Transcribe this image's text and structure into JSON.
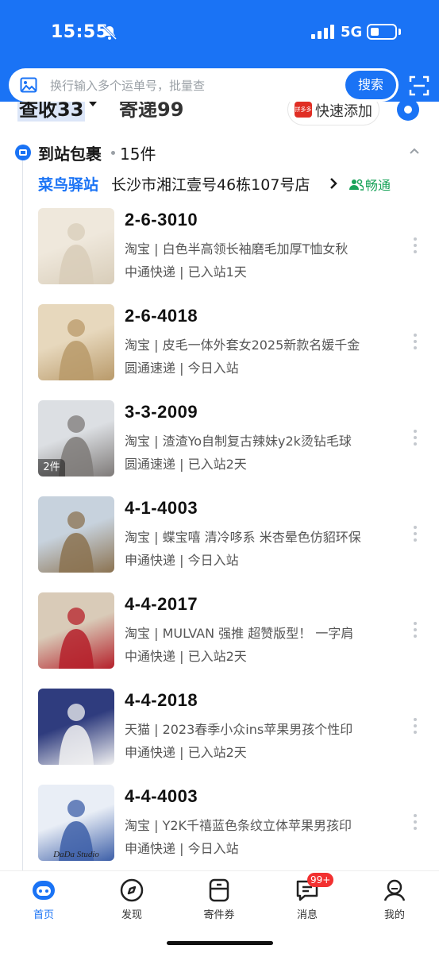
{
  "status_bar": {
    "time": "15:55",
    "network": "5G",
    "battery_level": 0.3
  },
  "search": {
    "placeholder": "换行输入多个运单号，批量查",
    "button_label": "搜索"
  },
  "summary": {
    "tab_1": "查收33",
    "tab_2": "寄递99",
    "quick_add_label": "快速添加",
    "quick_add_logo": "拼多多"
  },
  "section": {
    "title": "到站包裹",
    "count": "15件"
  },
  "station": {
    "brand": "菜鸟驿站",
    "name": "长沙市湘江壹号46栋107号店",
    "tag": "畅通"
  },
  "packages": [
    {
      "code": "2-6-3010",
      "desc": "淘宝 | 白色半高领长袖磨毛加厚T恤女秋",
      "status": "中通快递 | 已入站1天",
      "thumb_colors": [
        "#efe8dc",
        "#d8cdb9"
      ]
    },
    {
      "code": "2-6-4018",
      "desc": "淘宝 | 皮毛一体外套女2025新款名媛千金",
      "status": "圆通速递 | 今日入站",
      "thumb_colors": [
        "#e7d8bd",
        "#b99a6a"
      ]
    },
    {
      "code": "3-3-2009",
      "desc": "淘宝 | 渣渣Yo自制复古辣妹y2k烫钻毛球",
      "status": "圆通速递 | 已入站2天",
      "thumb_colors": [
        "#dcdfe3",
        "#7e7a78"
      ],
      "badge": "2件"
    },
    {
      "code": "4-1-4003",
      "desc": "淘宝 | 蝶宝嘻 清冷哆系 米杏晕色仿貂环保",
      "status": "申通快递 | 今日入站",
      "thumb_colors": [
        "#c7d2dd",
        "#8b7250"
      ]
    },
    {
      "code": "4-4-2017",
      "desc": "淘宝 | MULVAN 强推 超赞版型！ 一字肩",
      "status": "中通快递 | 已入站2天",
      "thumb_colors": [
        "#d9cbb8",
        "#b5202a"
      ]
    },
    {
      "code": "4-4-2018",
      "desc": "天猫 | 2023春季小众ins苹果男孩个性印",
      "status": "申通快递 | 已入站2天",
      "thumb_colors": [
        "#2f3c7e",
        "#f2f2f2"
      ]
    },
    {
      "code": "4-4-4003",
      "desc": "淘宝 | Y2K千禧蓝色条纹立体苹果男孩印",
      "status": "申通快递 | 今日入站",
      "thumb_colors": [
        "#e9eef6",
        "#3d5fa8"
      ],
      "thumb_text": "DaDa Studio"
    }
  ],
  "tabs": [
    {
      "label": "首页",
      "icon": "home-robot-icon",
      "active": true
    },
    {
      "label": "发现",
      "icon": "compass-icon"
    },
    {
      "label": "寄件券",
      "icon": "coupon-box-icon"
    },
    {
      "label": "消息",
      "icon": "message-icon",
      "badge": "99+"
    },
    {
      "label": "我的",
      "icon": "profile-icon"
    }
  ],
  "colors": {
    "primary": "#1a73f5",
    "station_tag": "#1aa35a",
    "badge": "#f23030"
  }
}
